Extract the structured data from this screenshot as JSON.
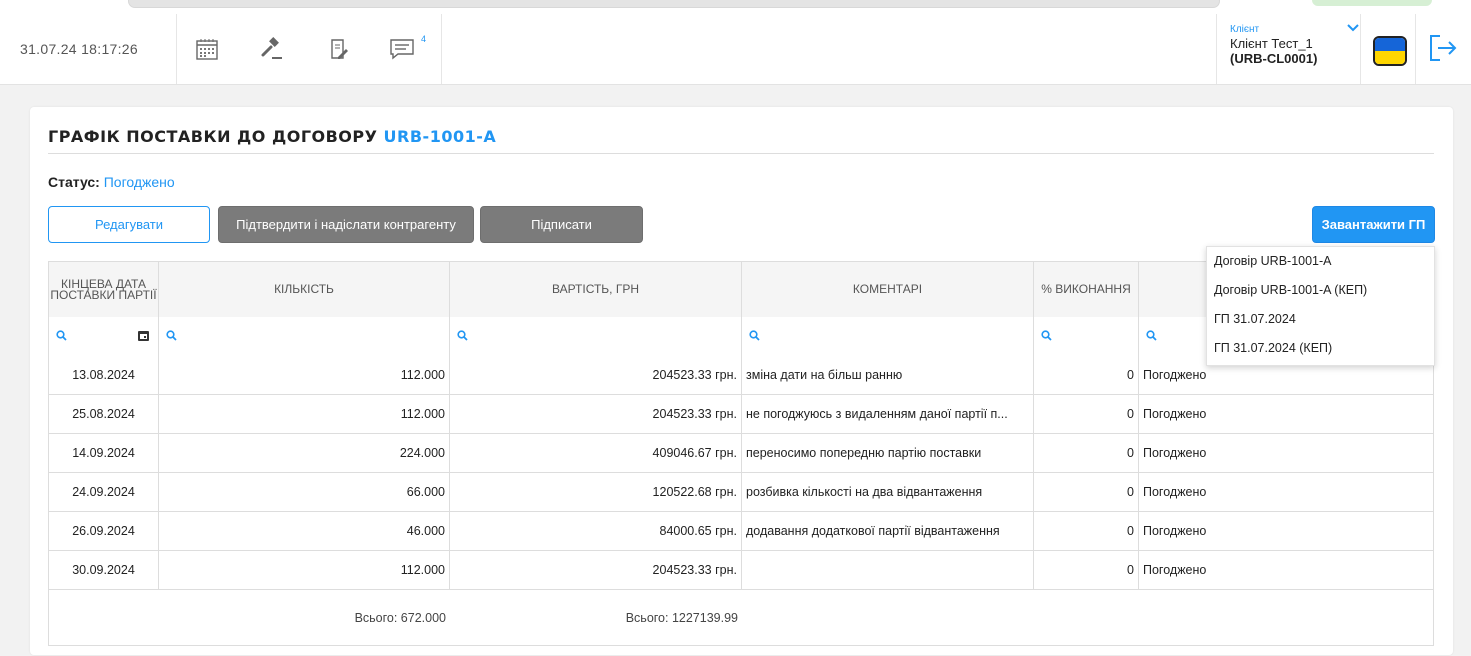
{
  "header": {
    "datetime": "31.07.24 18:17:26",
    "icons": [
      "calendar-icon",
      "gavel-icon",
      "document-edit-icon",
      "messages-icon"
    ],
    "messages_badge": "4",
    "client": {
      "label": "Клієнт",
      "name": "Клієнт Тест_1",
      "code": "(URB-CL0001)"
    },
    "language_flag": "ukraine-flag-icon"
  },
  "page": {
    "title_prefix": "ГРАФІК ПОСТАВКИ ДО ДОГОВОРУ",
    "contract_code": "URB-1001-A",
    "status_label": "Статус:",
    "status_value": "Погоджено"
  },
  "buttons": {
    "edit": "Редагувати",
    "confirm_send": "Підтвердити і надіслати контрагенту",
    "sign": "Підписати",
    "download": "Завантажити ГП"
  },
  "download_menu": [
    "Договір URB-1001-A",
    "Договір URB-1001-A (КЕП)",
    "ГП 31.07.2024",
    "ГП 31.07.2024 (КЕП)"
  ],
  "table": {
    "columns": {
      "end_date": "КІНЦЕВА ДАТА ПОСТАВКИ ПАРТІЇ",
      "quantity": "КІЛЬКІСТЬ",
      "cost": "ВАРТІСТЬ, ГРН",
      "comments": "КОМЕНТАРІ",
      "completion": "% ВИКОНАННЯ"
    },
    "rows": [
      {
        "date": "13.08.2024",
        "qty": "112.000",
        "cost": "204523.33 грн.",
        "comment": "зміна дати на більш ранню",
        "pct": "0",
        "status": "Погоджено"
      },
      {
        "date": "25.08.2024",
        "qty": "112.000",
        "cost": "204523.33 грн.",
        "comment": "не погоджуюсь з видаленням даної партії п...",
        "pct": "0",
        "status": "Погоджено"
      },
      {
        "date": "14.09.2024",
        "qty": "224.000",
        "cost": "409046.67 грн.",
        "comment": "переносимо попередню партію поставки",
        "pct": "0",
        "status": "Погоджено"
      },
      {
        "date": "24.09.2024",
        "qty": "66.000",
        "cost": "120522.68 грн.",
        "comment": "розбивка кількості на два відвантаження",
        "pct": "0",
        "status": "Погоджено"
      },
      {
        "date": "26.09.2024",
        "qty": "46.000",
        "cost": "84000.65 грн.",
        "comment": "додавання додаткової партії відвантаження",
        "pct": "0",
        "status": "Погоджено"
      },
      {
        "date": "30.09.2024",
        "qty": "112.000",
        "cost": "204523.33 грн.",
        "comment": "",
        "pct": "0",
        "status": "Погоджено"
      }
    ],
    "totals": {
      "quantity": "Всього: 672.000",
      "cost": "Всього: 1227139.99"
    }
  },
  "colors": {
    "accent": "#2196f3",
    "button_gray": "#7b7b7b"
  }
}
